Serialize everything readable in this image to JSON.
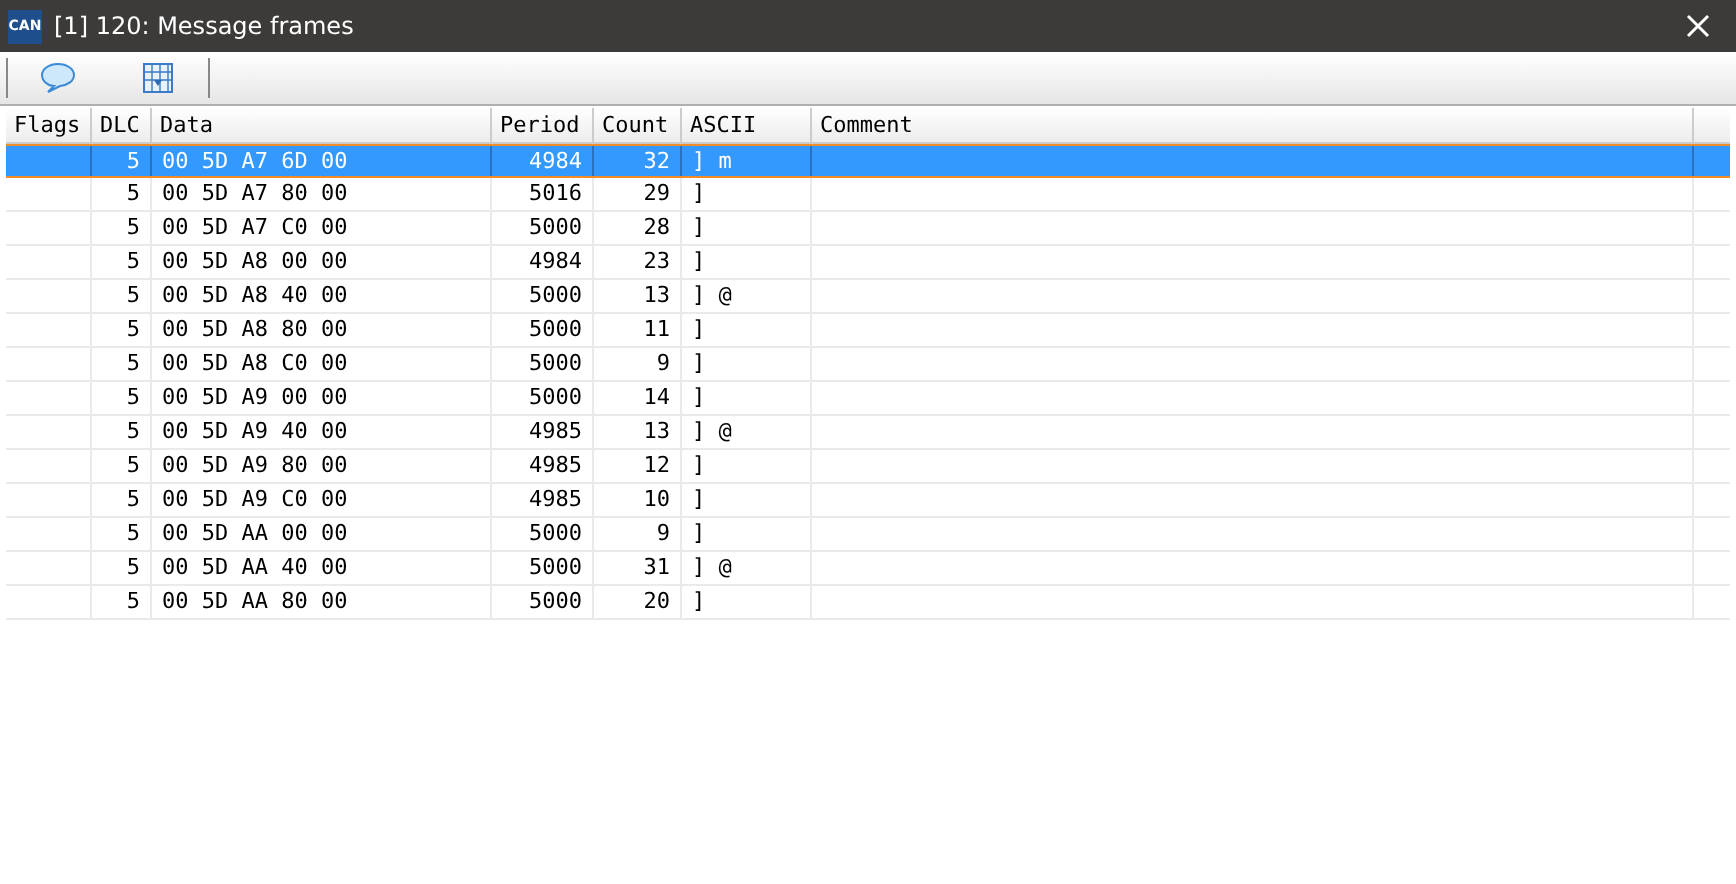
{
  "window": {
    "title": "[1] 120: Message frames",
    "logo": "CAN"
  },
  "table": {
    "columns": [
      "Flags",
      "DLC",
      "Data",
      "Period",
      "Count",
      "ASCII",
      "Comment"
    ],
    "rows": [
      {
        "dlc": "5",
        "data": "00 5D A7 6D 00",
        "period": "4984",
        "count": "32",
        "ascii": "] m",
        "selected": true
      },
      {
        "dlc": "5",
        "data": "00 5D A7 80 00",
        "period": "5016",
        "count": "29",
        "ascii": "]",
        "selected": false
      },
      {
        "dlc": "5",
        "data": "00 5D A7 C0 00",
        "period": "5000",
        "count": "28",
        "ascii": "]",
        "selected": false
      },
      {
        "dlc": "5",
        "data": "00 5D A8 00 00",
        "period": "4984",
        "count": "23",
        "ascii": "]",
        "selected": false
      },
      {
        "dlc": "5",
        "data": "00 5D A8 40 00",
        "period": "5000",
        "count": "13",
        "ascii": "] @",
        "selected": false
      },
      {
        "dlc": "5",
        "data": "00 5D A8 80 00",
        "period": "5000",
        "count": "11",
        "ascii": "]",
        "selected": false
      },
      {
        "dlc": "5",
        "data": "00 5D A8 C0 00",
        "period": "5000",
        "count": "9",
        "ascii": "]",
        "selected": false
      },
      {
        "dlc": "5",
        "data": "00 5D A9 00 00",
        "period": "5000",
        "count": "14",
        "ascii": "]",
        "selected": false
      },
      {
        "dlc": "5",
        "data": "00 5D A9 40 00",
        "period": "4985",
        "count": "13",
        "ascii": "] @",
        "selected": false
      },
      {
        "dlc": "5",
        "data": "00 5D A9 80 00",
        "period": "4985",
        "count": "12",
        "ascii": "]",
        "selected": false
      },
      {
        "dlc": "5",
        "data": "00 5D A9 C0 00",
        "period": "4985",
        "count": "10",
        "ascii": "]",
        "selected": false
      },
      {
        "dlc": "5",
        "data": "00 5D AA 00 00",
        "period": "5000",
        "count": "9",
        "ascii": "]",
        "selected": false
      },
      {
        "dlc": "5",
        "data": "00 5D AA 40 00",
        "period": "5000",
        "count": "31",
        "ascii": "] @",
        "selected": false
      },
      {
        "dlc": "5",
        "data": "00 5D AA 80 00",
        "period": "5000",
        "count": "20",
        "ascii": "]",
        "selected": false
      }
    ]
  }
}
